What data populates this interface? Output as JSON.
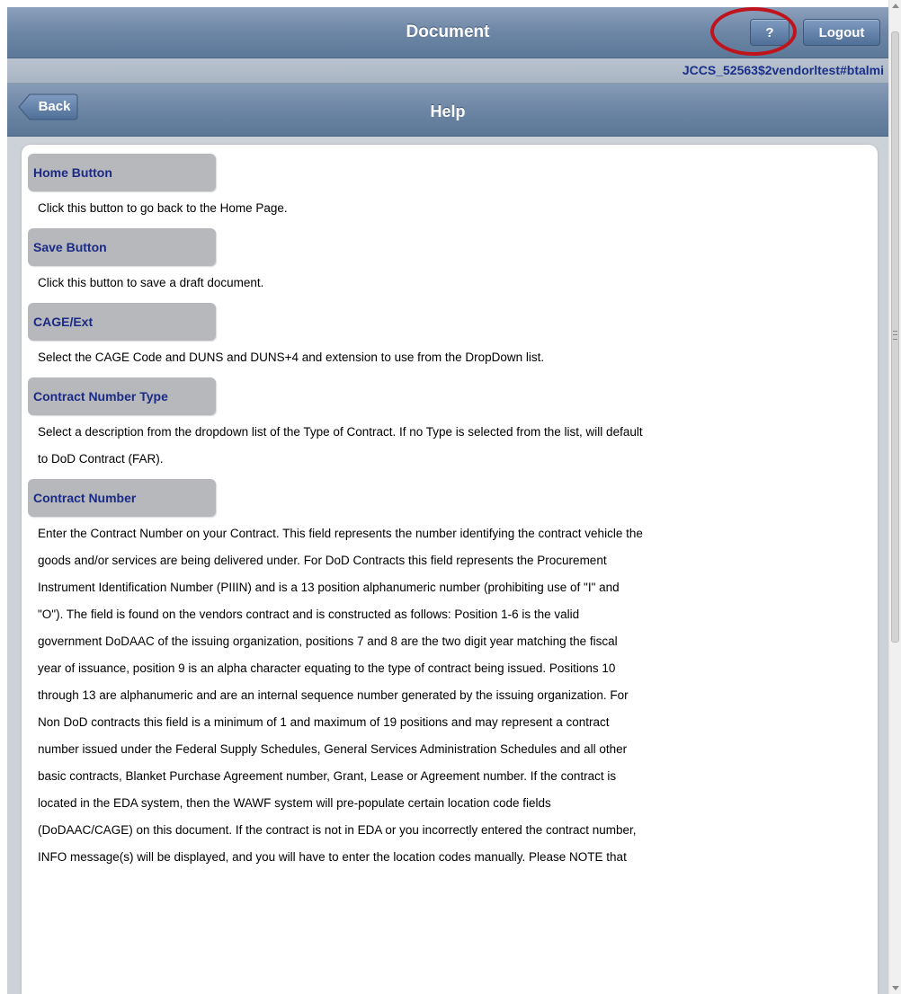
{
  "header": {
    "title": "Document",
    "help_label": "?",
    "logout_label": "Logout"
  },
  "user_bar": {
    "user_id": "JCCS_52563$2vendorltest#btalmi"
  },
  "nav": {
    "back_label": "Back",
    "title": "Help"
  },
  "sections": [
    {
      "heading": "Home Button",
      "body": [
        "Click this button to go back to the Home Page."
      ]
    },
    {
      "heading": "Save Button",
      "body": [
        "Click this button to save a draft document."
      ]
    },
    {
      "heading": "CAGE/Ext",
      "body": [
        "Select the CAGE Code and DUNS and DUNS+4 and extension to use from the DropDown list."
      ]
    },
    {
      "heading": "Contract Number Type",
      "body": [
        "Select a description from the dropdown list of the Type of Contract. If no Type is selected from the list, will default",
        "to DoD Contract (FAR)."
      ]
    },
    {
      "heading": "Contract Number",
      "body": [
        "Enter the Contract Number on your Contract. This field represents the number identifying the contract vehicle the",
        "goods and/or services are being delivered under. For DoD Contracts this field represents the Procurement",
        "Instrument Identification Number (PIIIN) and is a 13 position alphanumeric number (prohibiting use of \"I\" and",
        "\"O\"). The field is found on the vendors contract and is constructed as follows: Position 1-6 is the valid",
        "government DoDAAC of the issuing organization, positions 7 and 8 are the two digit year matching the fiscal",
        "year of issuance, position 9 is an alpha character equating to the type of contract being issued. Positions 10",
        "through 13 are alphanumeric and are an internal sequence number generated by the issuing organization. For",
        "Non DoD contracts this field is a minimum of 1 and maximum of 19 positions and may represent a contract",
        "number issued under the Federal Supply Schedules, General Services Administration Schedules and all other",
        "basic contracts, Blanket Purchase Agreement number, Grant, Lease or Agreement number. If the contract is",
        "located in the EDA system, then the WAWF system will pre-populate certain location code fields",
        "(DoDAAC/CAGE) on this document. If the contract is not in EDA or you incorrectly entered the contract number,",
        "INFO message(s) will be displayed, and you will have to enter the location codes manually. Please NOTE that"
      ]
    }
  ],
  "colors": {
    "highlight_circle": "#c0141c",
    "section_heading_text": "#1a2a86",
    "header_gradient_top": "#8ba0bb",
    "header_gradient_bottom": "#5c7898"
  }
}
